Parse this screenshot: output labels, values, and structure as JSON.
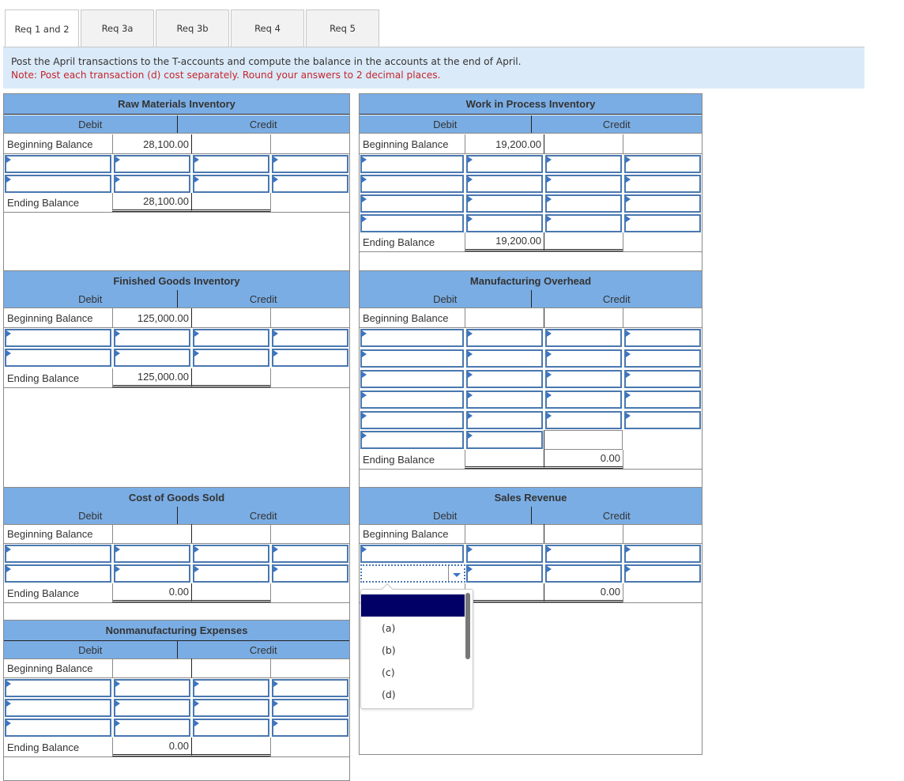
{
  "tabs": [
    {
      "label": "Req 1 and 2",
      "active": true
    },
    {
      "label": "Req 3a",
      "active": false
    },
    {
      "label": "Req 3b",
      "active": false
    },
    {
      "label": "Req 4",
      "active": false
    },
    {
      "label": "Req 5",
      "active": false
    }
  ],
  "instructions": {
    "main": "Post the April transactions to the T-accounts and compute the balance in the accounts at the end of April.",
    "note": "Note: Post each transaction (d) cost separately. Round your answers to 2 decimal places."
  },
  "labels": {
    "debit": "Debit",
    "credit": "Credit",
    "beginning_balance": "Beginning Balance",
    "ending_balance": "Ending Balance"
  },
  "accounts": {
    "raw_materials": {
      "title": "Raw Materials Inventory",
      "beginning_debit": "28,100.00",
      "ending_debit": "28,100.00",
      "ending_credit": ""
    },
    "work_in_process": {
      "title": "Work in Process Inventory",
      "beginning_debit": "19,200.00",
      "ending_debit": "19,200.00",
      "ending_credit": ""
    },
    "finished_goods": {
      "title": "Finished Goods Inventory",
      "beginning_debit": "125,000.00",
      "ending_debit": "125,000.00",
      "ending_credit": ""
    },
    "manufacturing_overhead": {
      "title": "Manufacturing Overhead",
      "beginning_debit": "",
      "ending_debit": "",
      "ending_credit": "0.00"
    },
    "cost_of_goods_sold": {
      "title": "Cost of Goods Sold",
      "beginning_debit": "",
      "ending_debit": "0.00",
      "ending_credit": ""
    },
    "sales_revenue": {
      "title": "Sales Revenue",
      "beginning_debit": "",
      "ending_debit": "",
      "ending_credit": "0.00"
    },
    "nonmanufacturing_expenses": {
      "title": "Nonmanufacturing Expenses",
      "beginning_debit": "",
      "ending_debit": "0.00",
      "ending_credit": ""
    }
  },
  "dropdown": {
    "options": [
      "",
      "(a)",
      "(b)",
      "(c)",
      "(d)"
    ],
    "highlighted_index": 0
  }
}
